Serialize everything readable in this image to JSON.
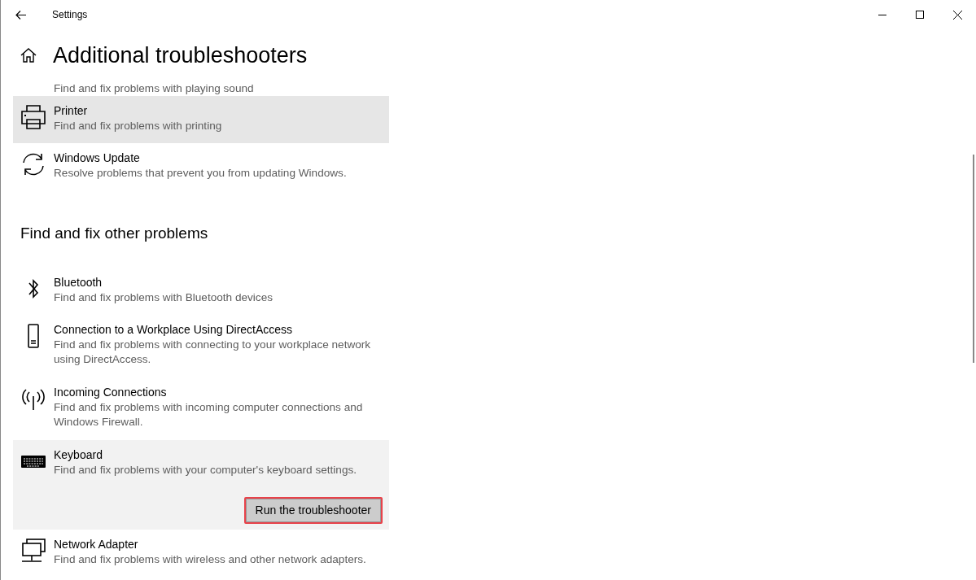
{
  "window": {
    "title": "Settings"
  },
  "page": {
    "title": "Additional troubleshooters"
  },
  "top_items": [
    {
      "description": "Find and fix problems with playing sound",
      "hovered": false,
      "expanded": false
    },
    {
      "title": "Printer",
      "description": "Find and fix problems with printing",
      "hovered": true,
      "expanded": false
    },
    {
      "title": "Windows Update",
      "description": "Resolve problems that prevent you from updating Windows.",
      "hovered": false,
      "expanded": false
    }
  ],
  "section": {
    "heading": "Find and fix other problems"
  },
  "other_items": [
    {
      "title": "Bluetooth",
      "description": "Find and fix problems with Bluetooth devices",
      "hovered": false,
      "expanded": false
    },
    {
      "title": "Connection to a Workplace Using DirectAccess",
      "description": "Find and fix problems with connecting to your workplace network using DirectAccess.",
      "hovered": false,
      "expanded": false
    },
    {
      "title": "Incoming Connections",
      "description": "Find and fix problems with incoming computer connections and Windows Firewall.",
      "hovered": false,
      "expanded": false
    },
    {
      "title": "Keyboard",
      "description": "Find and fix problems with your computer's keyboard settings.",
      "hovered": false,
      "expanded": true,
      "button": "Run the troubleshooter"
    },
    {
      "title": "Network Adapter",
      "description": "Find and fix problems with wireless and other network adapters.",
      "hovered": false,
      "expanded": false
    }
  ]
}
